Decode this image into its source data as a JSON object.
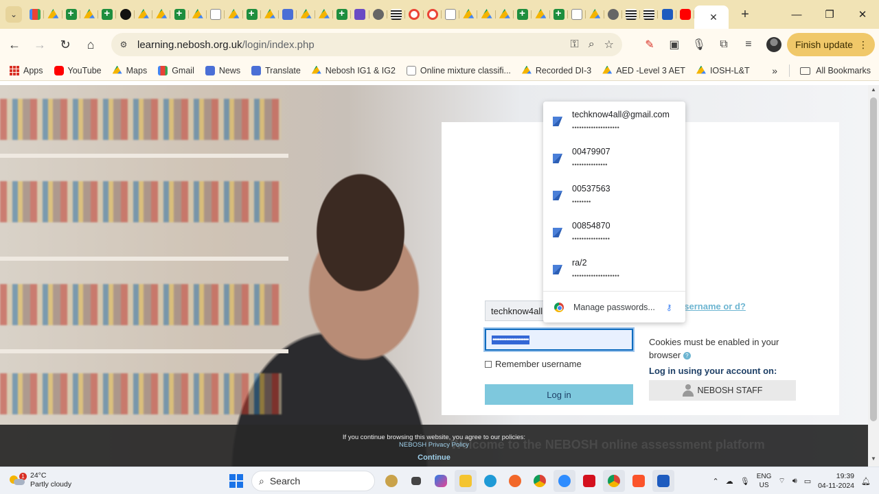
{
  "browser": {
    "tab_count_visible": 38,
    "active_tab_close": "✕",
    "new_tab": "+",
    "window_controls": {
      "minimize": "—",
      "restore": "❐",
      "close": "✕"
    }
  },
  "toolbar": {
    "url_host": "learning.nebosh.org.uk",
    "url_path": "/login/index.php",
    "finish_update_label": "Finish update"
  },
  "bookmarks": [
    {
      "label": "Apps",
      "icon": "apps-icon"
    },
    {
      "label": "YouTube",
      "icon": "youtube-icon"
    },
    {
      "label": "Maps",
      "icon": "maps-icon"
    },
    {
      "label": "Gmail",
      "icon": "gmail-icon"
    },
    {
      "label": "News",
      "icon": "news-icon"
    },
    {
      "label": "Translate",
      "icon": "translate-icon"
    },
    {
      "label": "Nebosh IG1 & IG2",
      "icon": "drive-icon"
    },
    {
      "label": "Online mixture classifi...",
      "icon": "hazard-icon"
    },
    {
      "label": "Recorded DI-3",
      "icon": "drive-icon"
    },
    {
      "label": "AED -Level 3 AET",
      "icon": "drive-icon"
    },
    {
      "label": "IOSH-L&T",
      "icon": "drive-icon"
    }
  ],
  "all_bookmarks_label": "All Bookmarks",
  "login": {
    "username_value": "techknow4all@",
    "password_value": "•••••••••••••••••••••",
    "remember_label": "Remember username",
    "login_button": "Log in",
    "forgot_link": "n your username or d?",
    "cookies_text": "Cookies must be enabled in your browser",
    "login_using": "Log in using your account on:",
    "staff_button": "NEBOSH STAFF"
  },
  "password_dropdown": {
    "items": [
      {
        "username": "techknow4all@gmail.com",
        "dots": "••••••••••••••••••••"
      },
      {
        "username": "00479907",
        "dots": "•••••••••••••••"
      },
      {
        "username": "00537563",
        "dots": "••••••••"
      },
      {
        "username": "00854870",
        "dots": "••••••••••••••••"
      },
      {
        "username": "ra/2",
        "dots": "••••••••••••••••••••"
      }
    ],
    "manage_label": "Manage passwords..."
  },
  "cookie_bar": {
    "text": "If you continue browsing this website, you agree to our policies:",
    "link": "NEBOSH Privacy Policy",
    "continue": "Continue",
    "welcome_behind": "Welcome to the NEBOSH online assessment platform"
  },
  "taskbar": {
    "temperature": "24°C",
    "weather": "Partly cloudy",
    "weather_badge": "1",
    "search_label": "Search",
    "lang_top": "ENG",
    "lang_bottom": "US",
    "time": "19:39",
    "date": "04-11-2024"
  }
}
